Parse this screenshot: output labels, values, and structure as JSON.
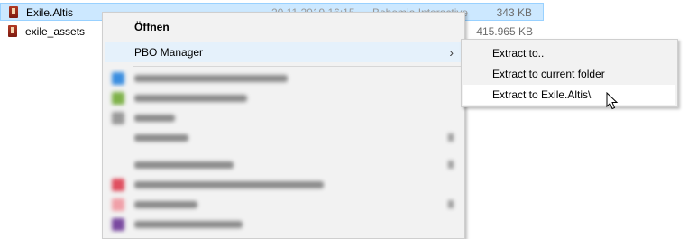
{
  "files": [
    {
      "name": "Exile.Altis",
      "date": "20.11.2019 16:15",
      "type": "Bohemia Interactive",
      "size": "343 KB",
      "selected": true
    },
    {
      "name": "exile_assets",
      "date": "",
      "type": "",
      "size": "415.965 KB",
      "selected": false
    }
  ],
  "context_menu": {
    "open_label": "Öffnen",
    "pbo_manager_label": "PBO Manager",
    "submenu_arrow": "›"
  },
  "submenu": {
    "items": [
      {
        "label": "Extract to.."
      },
      {
        "label": "Extract to current folder"
      },
      {
        "label": "Extract to Exile.Altis\\"
      }
    ]
  },
  "colors": {
    "selection_bg": "#cce8ff",
    "menu_bg": "#f2f2f2",
    "menu_highlight": "#e5f1fb"
  }
}
